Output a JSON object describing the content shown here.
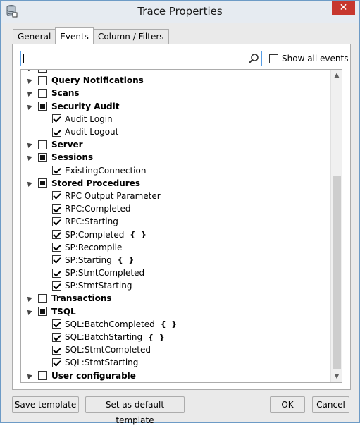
{
  "window": {
    "title": "Trace Properties"
  },
  "tabs": [
    {
      "label": "General"
    },
    {
      "label": "Events"
    },
    {
      "label": "Column / Filters"
    }
  ],
  "search": {
    "value": "",
    "placeholder": ""
  },
  "show_all_events": {
    "label": "Show all events",
    "checked": false
  },
  "tree": [
    {
      "kind": "cat",
      "label": "Query Notifications",
      "state": "unchecked"
    },
    {
      "kind": "cat",
      "label": "Scans",
      "state": "unchecked"
    },
    {
      "kind": "cat",
      "label": "Security Audit",
      "state": "partial"
    },
    {
      "kind": "evt",
      "label": "Audit Login",
      "state": "checked",
      "braces": ""
    },
    {
      "kind": "evt",
      "label": "Audit Logout",
      "state": "checked",
      "braces": ""
    },
    {
      "kind": "cat",
      "label": "Server",
      "state": "unchecked"
    },
    {
      "kind": "cat",
      "label": "Sessions",
      "state": "partial"
    },
    {
      "kind": "evt",
      "label": "ExistingConnection",
      "state": "checked",
      "braces": ""
    },
    {
      "kind": "cat",
      "label": "Stored Procedures",
      "state": "partial"
    },
    {
      "kind": "evt",
      "label": "RPC Output Parameter",
      "state": "checked",
      "braces": ""
    },
    {
      "kind": "evt",
      "label": "RPC:Completed",
      "state": "checked",
      "braces": ""
    },
    {
      "kind": "evt",
      "label": "RPC:Starting",
      "state": "checked",
      "braces": ""
    },
    {
      "kind": "evt",
      "label": "SP:Completed",
      "state": "checked",
      "braces": "{ }"
    },
    {
      "kind": "evt",
      "label": "SP:Recompile",
      "state": "checked",
      "braces": ""
    },
    {
      "kind": "evt",
      "label": "SP:Starting",
      "state": "checked",
      "braces": "{ }"
    },
    {
      "kind": "evt",
      "label": "SP:StmtCompleted",
      "state": "checked",
      "braces": ""
    },
    {
      "kind": "evt",
      "label": "SP:StmtStarting",
      "state": "checked",
      "braces": ""
    },
    {
      "kind": "cat",
      "label": "Transactions",
      "state": "unchecked"
    },
    {
      "kind": "cat",
      "label": "TSQL",
      "state": "partial"
    },
    {
      "kind": "evt",
      "label": "SQL:BatchCompleted",
      "state": "checked",
      "braces": "{ }"
    },
    {
      "kind": "evt",
      "label": "SQL:BatchStarting",
      "state": "checked",
      "braces": "{ }"
    },
    {
      "kind": "evt",
      "label": "SQL:StmtCompleted",
      "state": "checked",
      "braces": ""
    },
    {
      "kind": "evt",
      "label": "SQL:StmtStarting",
      "state": "checked",
      "braces": ""
    },
    {
      "kind": "cat",
      "label": "User configurable",
      "state": "unchecked"
    }
  ],
  "buttons": {
    "save_template": "Save template",
    "set_default": "Set as default template",
    "ok": "OK",
    "cancel": "Cancel"
  },
  "colors": {
    "accent": "#569de5",
    "close": "#c7372e"
  }
}
